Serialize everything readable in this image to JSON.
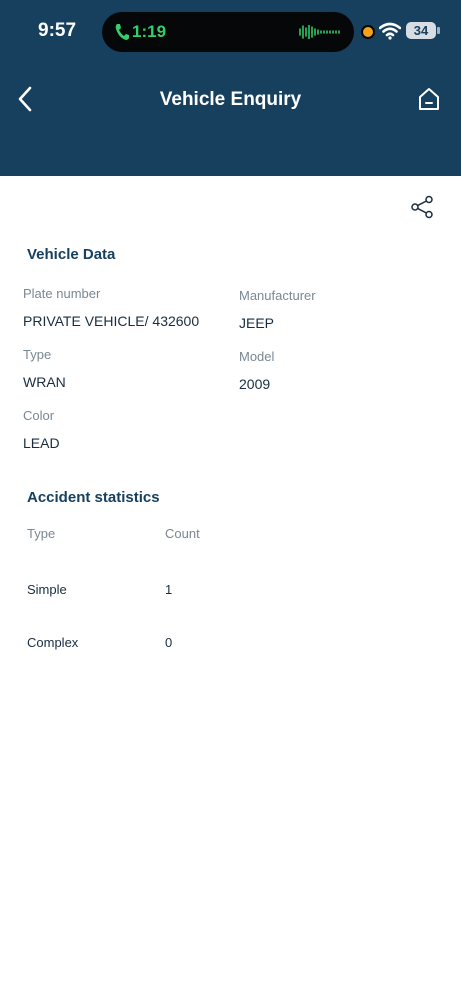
{
  "status_bar": {
    "time": "9:57",
    "call_duration": "1:19",
    "battery": "34",
    "call_color": "#33d06a",
    "record_dot_color": "#f6a219"
  },
  "header": {
    "title": "Vehicle Enquiry",
    "background_color": "#17405f",
    "back_icon": "chevron-left-icon",
    "home_icon": "home-icon"
  },
  "share_icon": "share-icon",
  "vehicle_data": {
    "title": "Vehicle Data",
    "plate_label": "Plate number",
    "plate_value": "PRIVATE VEHICLE/ 432600",
    "manufacturer_label": "Manufacturer",
    "manufacturer_value": "JEEP",
    "type_label": "Type",
    "type_value": "WRAN",
    "model_label": "Model",
    "model_value": "2009",
    "color_label": "Color",
    "color_value": "LEAD"
  },
  "accident_statistics": {
    "title": "Accident statistics",
    "columns": [
      "Type",
      "Count"
    ],
    "rows": [
      {
        "type": "Simple",
        "count": "1"
      },
      {
        "type": "Complex",
        "count": "0"
      }
    ]
  }
}
